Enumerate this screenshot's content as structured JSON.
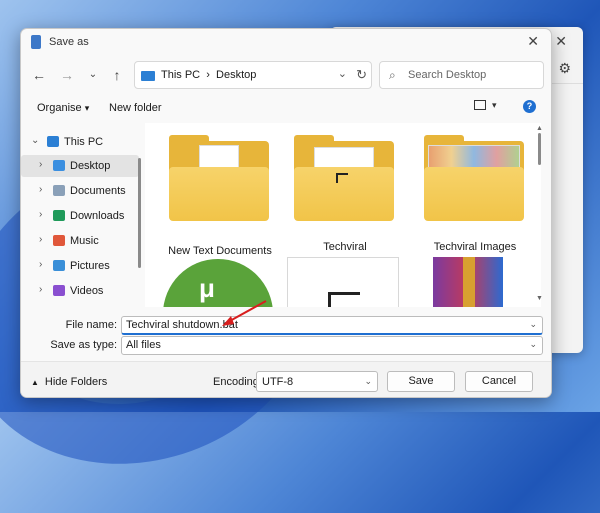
{
  "dialog": {
    "title": "Save as"
  },
  "nav": {
    "path_root": "This PC",
    "path_separator": "›",
    "path_current": "Desktop"
  },
  "search": {
    "placeholder": "Search Desktop"
  },
  "commands": {
    "organise": "Organise",
    "organise_chevron": "▾",
    "new_folder": "New folder",
    "help": "?"
  },
  "sidebar": {
    "items": [
      {
        "label": "This PC"
      },
      {
        "label": "Desktop"
      },
      {
        "label": "Documents"
      },
      {
        "label": "Downloads"
      },
      {
        "label": "Music"
      },
      {
        "label": "Pictures"
      },
      {
        "label": "Videos"
      }
    ]
  },
  "files": {
    "items": [
      {
        "label": "New Text Documents"
      },
      {
        "label": "Techviral"
      },
      {
        "label": "Techviral Images"
      }
    ]
  },
  "form": {
    "file_name_label": "File name:",
    "file_name_value": "Techviral shutdown.bat",
    "save_type_label": "Save as type:",
    "save_type_value": "All files"
  },
  "footer": {
    "hide_folders": "Hide Folders",
    "encoding_label": "Encoding:",
    "encoding_value": "UTF-8",
    "save": "Save",
    "cancel": "Cancel"
  },
  "colors": {
    "accent": "#1f6fd1",
    "folder": "#f1c448",
    "annotation_arrow": "#d81e1e"
  }
}
